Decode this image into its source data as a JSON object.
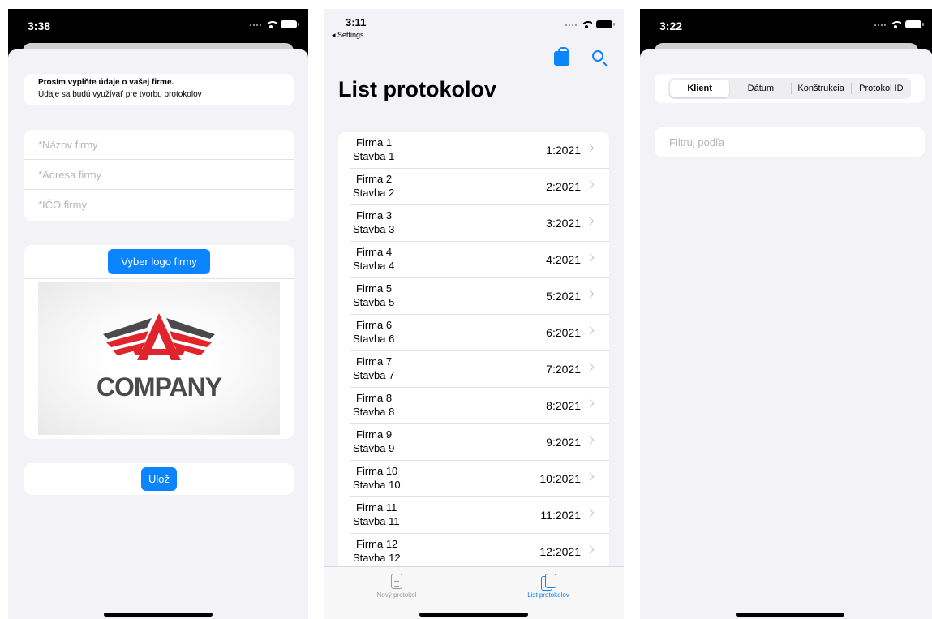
{
  "panel1": {
    "time": "3:38",
    "info_title": "Prosím vyplňte údaje o vašej firme.",
    "info_subtitle": "Údaje sa budú využívať pre tvorbu protokolov",
    "fields": [
      {
        "placeholder": "*Názov firmy"
      },
      {
        "placeholder": "*Adresa firmy"
      },
      {
        "placeholder": "*IČO firmy"
      }
    ],
    "logo_button": "Vyber logo firmy",
    "logo_text": "COMPANY",
    "save_button": "Ulož",
    "colors": {
      "accent": "#0a84ff",
      "logo_red": "#e0242b",
      "logo_gray": "#4a4a4c"
    }
  },
  "panel2": {
    "time": "3:11",
    "back_label": "◂ Settings",
    "title": "List protokolov",
    "rows": [
      {
        "firma": "Firma 1",
        "stavba": "Stavba 1",
        "id": "1:2021"
      },
      {
        "firma": "Firma 2",
        "stavba": "Stavba 2",
        "id": "2:2021"
      },
      {
        "firma": "Firma 3",
        "stavba": "Stavba 3",
        "id": "3:2021"
      },
      {
        "firma": "Firma 4",
        "stavba": "Stavba 4",
        "id": "4:2021"
      },
      {
        "firma": "Firma 5",
        "stavba": "Stavba 5",
        "id": "5:2021"
      },
      {
        "firma": "Firma 6",
        "stavba": "Stavba 6",
        "id": "6:2021"
      },
      {
        "firma": "Firma 7",
        "stavba": "Stavba 7",
        "id": "7:2021"
      },
      {
        "firma": "Firma 8",
        "stavba": "Stavba 8",
        "id": "8:2021"
      },
      {
        "firma": "Firma 9",
        "stavba": "Stavba 9",
        "id": "9:2021"
      },
      {
        "firma": "Firma 10",
        "stavba": "Stavba 10",
        "id": "10:2021"
      },
      {
        "firma": "Firma 11",
        "stavba": "Stavba 11",
        "id": "11:2021"
      },
      {
        "firma": "Firma 12",
        "stavba": "Stavba 12",
        "id": "12:2021"
      }
    ],
    "tabs": [
      {
        "label": "Nový protokol",
        "icon": "doc-icon",
        "color": "#999999"
      },
      {
        "label": "List protokolov",
        "icon": "docs-icon",
        "color": "#0a84ff"
      }
    ]
  },
  "panel3": {
    "time": "3:22",
    "segments": [
      "Klient",
      "Dátum",
      "Konštrukcia",
      "Protokol ID"
    ],
    "selected_segment": "Klient",
    "filter_placeholder": "Filtruj podľa"
  }
}
